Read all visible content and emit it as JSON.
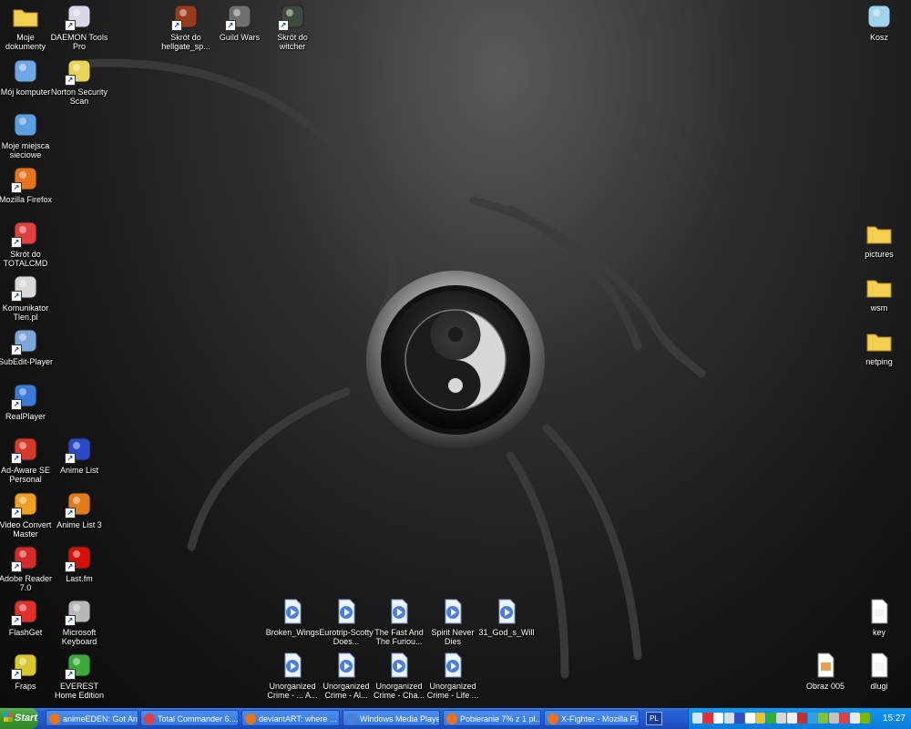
{
  "desktop_icons": [
    {
      "label": "Moje dokumenty",
      "icon": "my-documents-folder-icon",
      "color": "#f3cf51",
      "shortcut": false
    },
    {
      "label": "DAEMON Tools Pro",
      "icon": "daemon-tools-icon",
      "color": "#d8d8e8",
      "shortcut": true
    },
    {
      "label": "Skrót do hellgate_sp...",
      "icon": "hellgate-game-icon",
      "color": "#9a3a1a",
      "shortcut": true
    },
    {
      "label": "Guild Wars",
      "icon": "guild-wars-icon",
      "color": "#6f6f6f",
      "shortcut": true
    },
    {
      "label": "Skrót do witcher",
      "icon": "witcher-game-icon",
      "color": "#3d4a3d",
      "shortcut": true
    },
    {
      "label": "Kosz",
      "icon": "recycle-bin-icon",
      "color": "#9fd3ee",
      "shortcut": false
    },
    {
      "label": "Mój komputer",
      "icon": "my-computer-icon",
      "color": "#6ea8e6",
      "shortcut": false
    },
    {
      "label": "Norton Security Scan",
      "icon": "norton-scan-icon",
      "color": "#e8d25a",
      "shortcut": true
    },
    {
      "label": "Moje miejsca sieciowe",
      "icon": "network-places-icon",
      "color": "#5aa0e0",
      "shortcut": false
    },
    {
      "label": "Mozilla Firefox",
      "icon": "firefox-icon",
      "color": "#e8731d",
      "shortcut": true
    },
    {
      "label": "Skrót do TOTALCMD",
      "icon": "total-commander-icon",
      "color": "#e04040",
      "shortcut": true
    },
    {
      "label": "Komunikator Tlen.pl",
      "icon": "tlen-messenger-icon",
      "color": "#d8d8d8",
      "shortcut": true
    },
    {
      "label": "SubEdit-Player",
      "icon": "subedit-player-icon",
      "color": "#7da6d8",
      "shortcut": true
    },
    {
      "label": "RealPlayer",
      "icon": "realplayer-icon",
      "color": "#3a7bd5",
      "shortcut": true
    },
    {
      "label": "Ad-Aware SE Personal",
      "icon": "adaware-icon",
      "color": "#d43a2a",
      "shortcut": true
    },
    {
      "label": "Anime List",
      "icon": "anime-list-icon",
      "color": "#2a48c8",
      "shortcut": true
    },
    {
      "label": "Video Convert Master",
      "icon": "video-convert-icon",
      "color": "#f0a020",
      "shortcut": true
    },
    {
      "label": "Anime List 3",
      "icon": "anime-list-3-icon",
      "color": "#e07a1a",
      "shortcut": true
    },
    {
      "label": "Adobe Reader 7.0",
      "icon": "adobe-reader-icon",
      "color": "#d42a2a",
      "shortcut": true
    },
    {
      "label": "Last.fm",
      "icon": "lastfm-icon",
      "color": "#d51007",
      "shortcut": true
    },
    {
      "label": "FlashGet",
      "icon": "flashget-icon",
      "color": "#e0302a",
      "shortcut": true
    },
    {
      "label": "Microsoft Keyboard",
      "icon": "keyboard-icon",
      "color": "#b8b8b8",
      "shortcut": true
    },
    {
      "label": "Fraps",
      "icon": "fraps-icon",
      "color": "#d8c830",
      "shortcut": true
    },
    {
      "label": "EVEREST Home Edition",
      "icon": "everest-info-icon",
      "color": "#3aa83a",
      "shortcut": true
    },
    {
      "label": "Broken_Wings",
      "icon": "media-file-icon",
      "color": "#4a7fd8",
      "shortcut": false
    },
    {
      "label": "Eurotrip-Scotty Does...",
      "icon": "media-file-icon",
      "color": "#4a7fd8",
      "shortcut": false
    },
    {
      "label": "The Fast And The Furiou...",
      "icon": "media-file-icon",
      "color": "#4a7fd8",
      "shortcut": false
    },
    {
      "label": "Spirit Never Dies",
      "icon": "media-file-icon",
      "color": "#4a7fd8",
      "shortcut": false
    },
    {
      "label": "31_God_s_Will",
      "icon": "media-file-icon",
      "color": "#4a7fd8",
      "shortcut": false
    },
    {
      "label": "Unorganized Crime - ... A...",
      "icon": "media-file-icon",
      "color": "#4a7fd8",
      "shortcut": false
    },
    {
      "label": "Unorganized Crime - Al...",
      "icon": "media-file-icon",
      "color": "#4a7fd8",
      "shortcut": false
    },
    {
      "label": "Unorganized Crime - Cha...",
      "icon": "media-file-icon",
      "color": "#4a7fd8",
      "shortcut": false
    },
    {
      "label": "Unorganized Crime - Life ...",
      "icon": "media-file-icon",
      "color": "#4a7fd8",
      "shortcut": false
    },
    {
      "label": "pictures",
      "icon": "folder-icon",
      "color": "#f3cf51",
      "shortcut": false
    },
    {
      "label": "wsm",
      "icon": "folder-icon",
      "color": "#f3cf51",
      "shortcut": false
    },
    {
      "label": "netping",
      "icon": "folder-icon",
      "color": "#f3cf51",
      "shortcut": false
    },
    {
      "label": "key",
      "icon": "text-file-icon",
      "color": "#f4f4f4",
      "shortcut": false
    },
    {
      "label": "Obraz 005",
      "icon": "image-file-icon",
      "color": "#e8a050",
      "shortcut": false
    },
    {
      "label": "dlugi",
      "icon": "text-file-icon",
      "color": "#f4f4f4",
      "shortcut": false
    }
  ],
  "taskbar": {
    "start_label": "Start",
    "tasks": [
      {
        "label": "animeEDEN: Got Ani...",
        "icon": "firefox-icon",
        "color": "#e8731d"
      },
      {
        "label": "Total Commander 6....",
        "icon": "total-commander-icon",
        "color": "#e04040"
      },
      {
        "label": "deviantART: where ...",
        "icon": "firefox-icon",
        "color": "#e8731d"
      },
      {
        "label": "Windows Media Player",
        "icon": "media-player-icon",
        "color": "#4a7fd8"
      },
      {
        "label": "Pobieranie 7% z 1 pl...",
        "icon": "firefox-icon",
        "color": "#e8731d"
      },
      {
        "label": "X-Fighter - Mozilla Fi...",
        "icon": "firefox-icon",
        "color": "#e8731d"
      }
    ],
    "language": "PL",
    "tray_icons": [
      {
        "icon": "tray-expand-icon",
        "color": "#cfe6ff"
      },
      {
        "icon": "antivirus-tray-icon",
        "color": "#e03030"
      },
      {
        "icon": "network-tray-icon",
        "color": "#ffffff"
      },
      {
        "icon": "tray-app-icon-1",
        "color": "#dddddd"
      },
      {
        "icon": "tray-app-icon-2",
        "color": "#3050c0"
      },
      {
        "icon": "tray-app-icon-3",
        "color": "#ffffff"
      },
      {
        "icon": "tray-app-icon-4",
        "color": "#e8c030"
      },
      {
        "icon": "tray-app-icon-5",
        "color": "#30b030"
      },
      {
        "icon": "tray-app-icon-6",
        "color": "#d8d8d8"
      },
      {
        "icon": "tray-app-icon-7",
        "color": "#f0f0f0"
      },
      {
        "icon": "tray-app-icon-8",
        "color": "#c03030"
      },
      {
        "icon": "tray-app-icon-9",
        "color": "#30a0e0"
      },
      {
        "icon": "tray-app-icon-10",
        "color": "#80c040"
      },
      {
        "icon": "tray-app-icon-11",
        "color": "#c0c0c0"
      },
      {
        "icon": "tray-app-icon-12",
        "color": "#e04040"
      },
      {
        "icon": "volume-icon",
        "color": "#e8e8e8"
      },
      {
        "icon": "nvidia-tray-icon",
        "color": "#76b900"
      }
    ],
    "clock": "15:27"
  }
}
